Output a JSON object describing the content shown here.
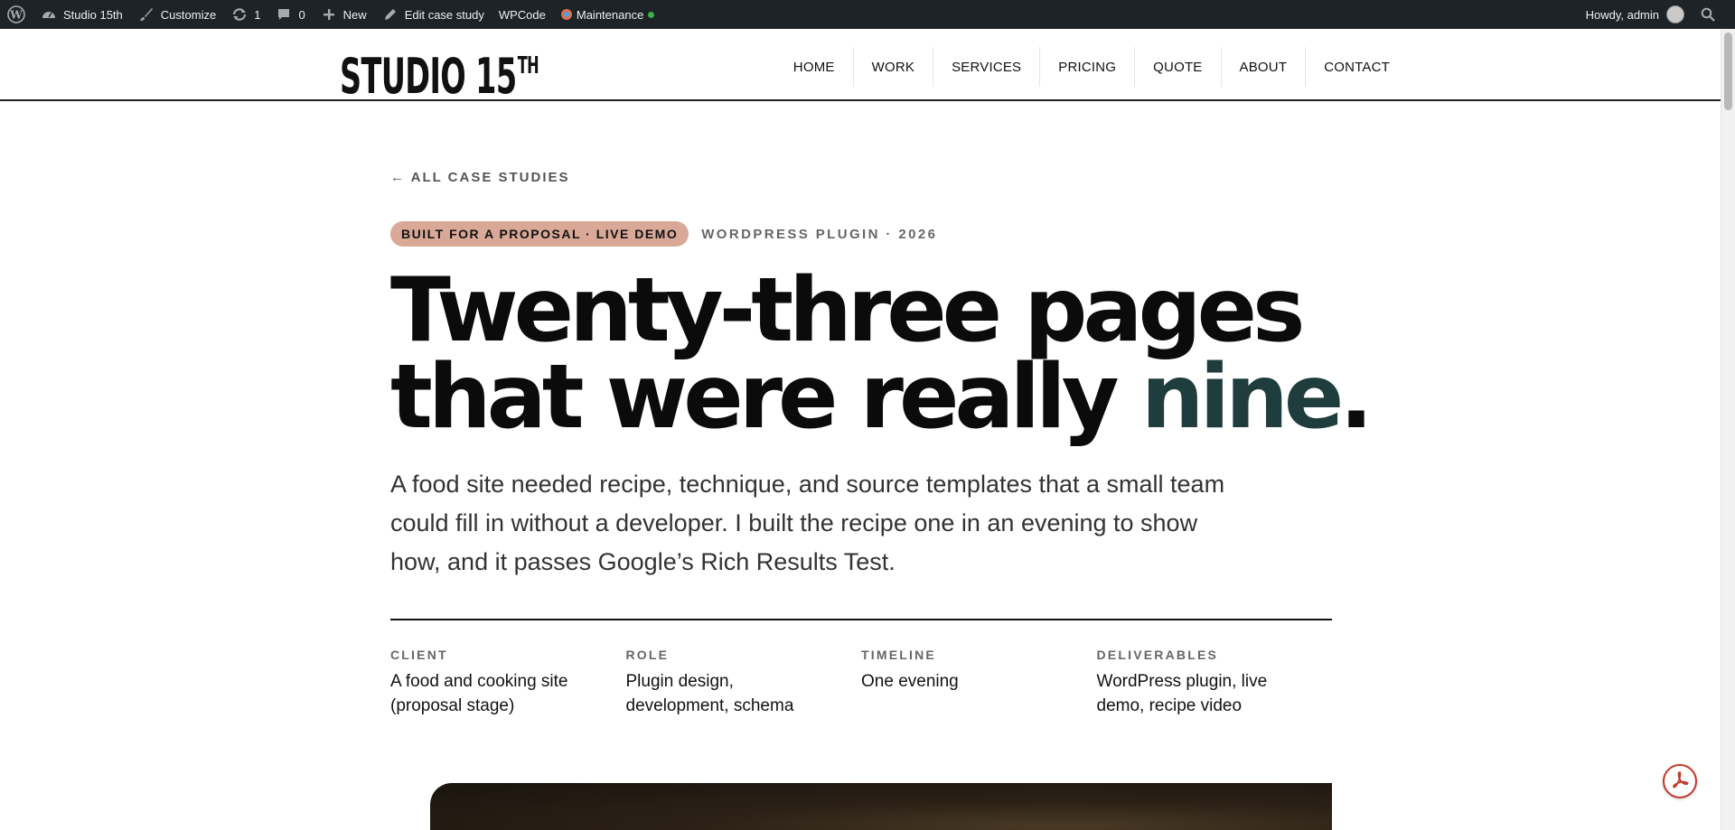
{
  "admin_bar": {
    "site_name": "Studio 15th",
    "customize": "Customize",
    "updates_count": "1",
    "comments_count": "0",
    "new_label": "New",
    "edit_label": "Edit case study",
    "wpcode_label": "WPCode",
    "maintenance_label": "Maintenance",
    "greeting": "Howdy, admin"
  },
  "header": {
    "logo_text": "STUDIO 15",
    "logo_sup": "TH",
    "nav": [
      "HOME",
      "WORK",
      "SERVICES",
      "PRICING",
      "QUOTE",
      "ABOUT",
      "CONTACT"
    ]
  },
  "article": {
    "back_link": "← ALL CASE STUDIES",
    "pill": "BUILT FOR A PROPOSAL · LIVE DEMO",
    "kicker": "WORDPRESS PLUGIN · 2026",
    "headline_line1": "Twenty-three pages",
    "headline_line2_pre": "that were really ",
    "headline_highlight": "nine",
    "headline_period": ".",
    "lede": "A food site needed recipe, technique, and source templates that a small team could fill in without a developer. I built the recipe one in an evening to show how, and it passes Google’s Rich Results Test.",
    "facts": [
      {
        "label": "CLIENT",
        "value": "A food and cooking site (proposal stage)"
      },
      {
        "label": "ROLE",
        "value": "Plugin design, development, schema"
      },
      {
        "label": "TIMELINE",
        "value": "One evening"
      },
      {
        "label": "DELIVERABLES",
        "value": "WordPress plugin, live demo, recipe video"
      }
    ]
  },
  "colors": {
    "accent_pill": "#d9a896",
    "highlight_text": "#1e3d3c",
    "admin_bar_bg": "#1d2327"
  }
}
